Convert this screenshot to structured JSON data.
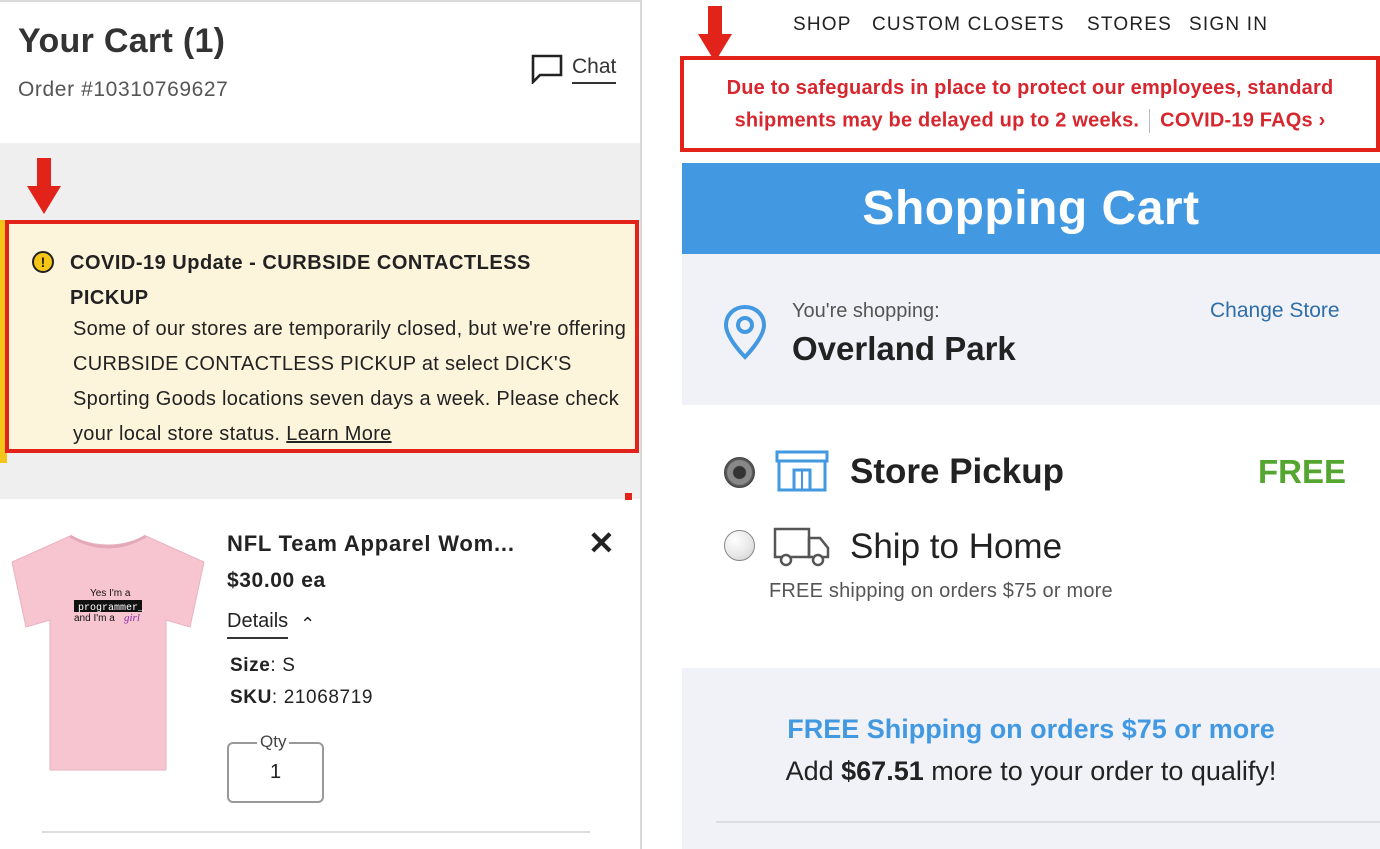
{
  "left": {
    "cart_title": "Your Cart (1)",
    "order_number": "Order #10310769627",
    "chat_label": "Chat",
    "covid_title": "COVID-19 Update - CURBSIDE CONTACTLESS PICKUP",
    "covid_body": "Some of our stores are temporarily closed, but we're offering CURBSIDE CONTACTLESS PICKUP at select DICK'S Sporting Goods locations seven days a week. Please check your local store status.",
    "learn_more": "Learn More",
    "product": {
      "name": "NFL Team Apparel Wom...",
      "price": "$30.00 ea",
      "details_label": "Details",
      "size_label": "Size",
      "size_value": "S",
      "sku_label": "SKU",
      "sku_value": "21068719",
      "qty_label": "Qty",
      "qty_value": "1",
      "shirt_text": {
        "line1": "Yes I'm a",
        "line2": "programmer_",
        "line3": "and I'm a",
        "line4": "girl"
      }
    }
  },
  "right": {
    "nav": [
      "SHOP",
      "CUSTOM CLOSETS",
      "STORES",
      "SIGN IN"
    ],
    "safeguard_line1": "Due to safeguards in place to protect our employees, standard",
    "safeguard_line2": "shipments may be delayed up to 2 weeks.",
    "covid_faq": "COVID-19 FAQs ›",
    "banner_title": "Shopping Cart",
    "shopping_label": "You're shopping:",
    "store_name": "Overland Park",
    "change_store": "Change Store",
    "options": [
      {
        "label": "Store Pickup",
        "selected": true,
        "icon": "storefront-icon"
      },
      {
        "label": "Ship to Home",
        "selected": false,
        "icon": "truck-icon"
      }
    ],
    "free_tag": "FREE",
    "ship_note": "FREE shipping on orders $75 or more",
    "promo_title": "FREE Shipping on orders $75 or more",
    "promo_prefix": "Add ",
    "promo_amount": "$67.51",
    "promo_suffix": " more to your order to qualify!"
  },
  "colors": {
    "highlight_red": "#e2231a",
    "banner_blue": "#4299e1",
    "free_green": "#55a630",
    "notice_bg": "#fdf4dc"
  }
}
